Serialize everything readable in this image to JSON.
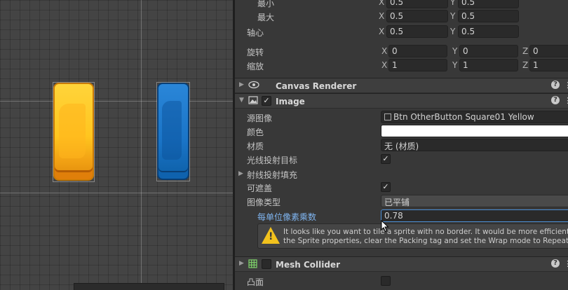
{
  "scene": {
    "sprites": [
      "btn-yellow",
      "btn-blue"
    ]
  },
  "rect_transform": {
    "min_label": "最小",
    "min_x": "0.5",
    "min_y": "0.5",
    "max_label": "最大",
    "max_x": "0.5",
    "max_y": "0.5",
    "pivot_label": "轴心",
    "pivot_x": "0.5",
    "pivot_y": "0.5",
    "rotation_label": "旋转",
    "rot_x": "0",
    "rot_y": "0",
    "rot_z": "0",
    "scale_label": "缩放",
    "scale_x": "1",
    "scale_y": "1",
    "scale_z": "1",
    "axis_x": "X",
    "axis_y": "Y",
    "axis_z": "Z"
  },
  "canvas_renderer": {
    "title": "Canvas Renderer"
  },
  "image": {
    "title": "Image",
    "enabled": "✓",
    "source_label": "源图像",
    "source_value": "Btn OtherButton Square01 Yellow",
    "color_label": "颜色",
    "material_label": "材质",
    "material_value": "无 (材质)",
    "raycast_label": "光线投射目标",
    "raycast_check": "✓",
    "raycast_padding_label": "射线投射填充",
    "maskable_label": "可遮盖",
    "maskable_check": "✓",
    "image_type_label": "图像类型",
    "image_type_value": "已平铺",
    "ppu_label": "每单位像素乘数",
    "ppu_value": "0.78",
    "warning_line1": "It looks like you want to tile a sprite with no border. It would be more efficient to mo",
    "warning_line2": "the Sprite properties, clear the Packing tag and set the Wrap mode to Repeat."
  },
  "mesh_collider": {
    "title": "Mesh Collider",
    "convex_label": "凸面"
  },
  "common": {
    "help": "?",
    "more": "⋮"
  },
  "colors": {
    "accent_label": "#7fb4ef",
    "warning": "#f2c21d",
    "yellow_sprite": "#ffc51f",
    "blue_sprite": "#1a74c7"
  }
}
